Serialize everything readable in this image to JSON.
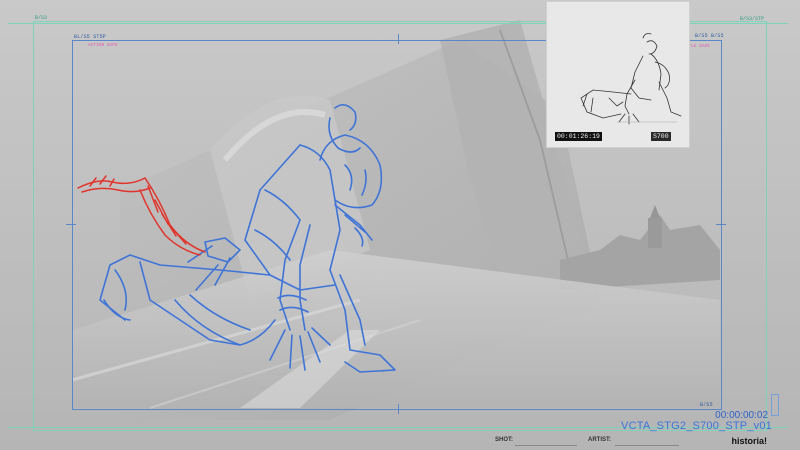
{
  "corners": {
    "top_left_outer": "B/S3",
    "top_right_outer": "B/S3/STP",
    "top_left_inner": "BL/S5 ST5P",
    "top_right_inner": "B/S5 B/S5",
    "bottom_right_inner": "B/S5",
    "pink_top_left": "ACTION SAFE",
    "pink_top_right": "TITLE SAFE"
  },
  "thumbnail": {
    "timecode": "00:01:26:19",
    "scene": "S700"
  },
  "overlay": {
    "timecode": "00:00:00:02",
    "filename": "VCTA_STG2_S700_STP_v01"
  },
  "footer": {
    "shot_label": "SHOT:",
    "artist_label": "ARTIST:",
    "logo": "historia!"
  },
  "colors": {
    "sketch_blue": "#3f74d6",
    "sketch_red": "#e0342c",
    "guide_green": "#7fd3b8",
    "guide_blue": "#5b86c8",
    "text_blue": "#3e74d8"
  }
}
